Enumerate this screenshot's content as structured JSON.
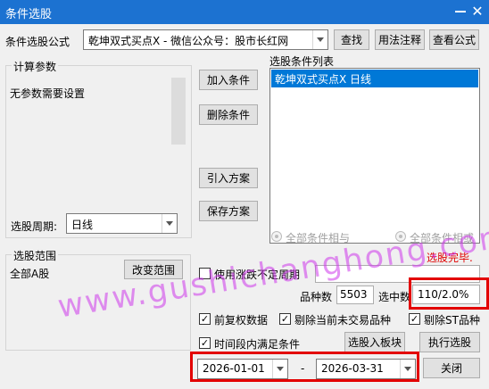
{
  "window": {
    "title": "条件选股",
    "minimize_icon": "minimize-icon",
    "close_glyph": "✕"
  },
  "formula": {
    "label": "条件选股公式",
    "value": "乾坤双式买点X  -  微信公众号：股市长红网",
    "find_button": "查找",
    "usage_button": "用法注释",
    "view_button": "查看公式"
  },
  "params": {
    "title": "计算参数",
    "text": "无参数需要设置",
    "period_label": "选股周期:",
    "period_value": "日线"
  },
  "condition_buttons": {
    "add": "加入条件",
    "delete": "删除条件",
    "import": "引入方案",
    "save": "保存方案"
  },
  "condition_list": {
    "title": "选股条件列表",
    "items": [
      "乾坤双式买点X  日线"
    ],
    "radio_and": "全部条件相与",
    "radio_or": "全部条件相或"
  },
  "status": {
    "done": "选股完毕.",
    "count_label": "品种数",
    "count_value": "5503",
    "selected_label": "选中数",
    "selected_value": "110/2.0%"
  },
  "scope": {
    "title": "选股范围",
    "text": "全部A股",
    "change_button": "改变范围"
  },
  "options": {
    "use_variable_period": "使用涨跌不定周期",
    "pre_adjust": "前复权数据",
    "exclude_untraded": "剔除当前未交易品种",
    "exclude_st": "剔除ST品种",
    "time_range": "时间段内满足条件"
  },
  "actions": {
    "to_block": "选股入板块",
    "execute": "执行选股",
    "close": "关闭"
  },
  "dates": {
    "start": "2026-01-01",
    "separator": "-",
    "end": "2026-03-31"
  },
  "watermark": "www.gushichanghong.com",
  "colors": {
    "titlebar": "#1c72d1",
    "selection": "#0078d7",
    "highlight_box": "#e30000",
    "status_done": "#e00000",
    "watermark": "#cd37eb"
  }
}
